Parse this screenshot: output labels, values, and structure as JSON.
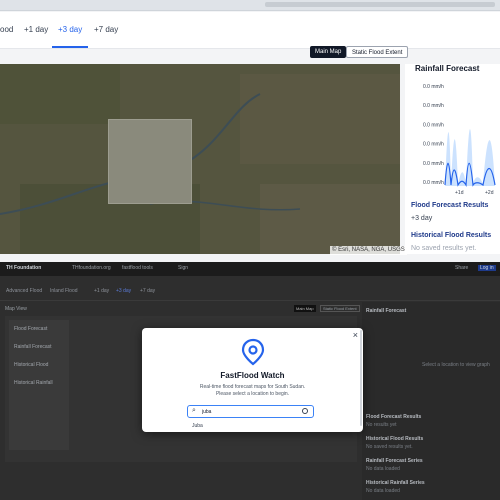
{
  "top": {
    "tabs": [
      {
        "label": "ood",
        "active": false
      },
      {
        "label": "+1 day",
        "active": false
      },
      {
        "label": "+3 day",
        "active": true
      },
      {
        "label": "+7 day",
        "active": false
      }
    ],
    "map_buttons": {
      "main": "Main Map",
      "static": "Static Flood Extent"
    },
    "attribution": "© Esri, NASA, NGA, USGS",
    "rainfall": {
      "title": "Rainfall Forecast",
      "y_ticks": [
        "0.0 mm/h",
        "0.0 mm/h",
        "0.0 mm/h",
        "0.0 mm/h",
        "0.0 mm/h",
        "0.0 mm/h"
      ],
      "x_ticks": [
        "+1d",
        "+2d"
      ]
    },
    "results": {
      "flood_label": "Flood Forecast Results",
      "flood_value": "+3 day",
      "historical_label": "Historical Flood Results",
      "historical_value": "No saved results yet."
    }
  },
  "bottom": {
    "header": {
      "org": "TH Foundation",
      "items": [
        "THfoundation.org",
        "fastflood tools",
        "Sign"
      ],
      "share": "Share",
      "login": "Log in"
    },
    "tabs": [
      "Advanced Flood",
      "Inland Flood",
      "+1 day",
      "+3 day",
      "+7 day"
    ],
    "map_view": "Map View",
    "buttons": [
      "Main Map",
      "Static Flood Extent"
    ],
    "layers": [
      "Flood Forecast",
      "Rainfall Forecast",
      "Historical Flood",
      "Historical Rainfall"
    ],
    "right": {
      "title": "Rainfall Forecast",
      "placeholder": "Select a location to view graph",
      "sections": [
        {
          "title": "Flood Forecast Results",
          "sub": "No results yet"
        },
        {
          "title": "Historical Flood Results",
          "sub": "No saved results yet."
        },
        {
          "title": "Rainfall Forecast Series",
          "sub": "No data loaded"
        },
        {
          "title": "Historical Rainfall Series",
          "sub": "No data loaded"
        }
      ]
    }
  },
  "modal": {
    "title": "FastFlood Watch",
    "description": "Real-time flood forecast maps for South Sudan.",
    "hint": "Please select a location to begin.",
    "search_value": "juba",
    "suggestion": "Juba"
  },
  "colors": {
    "accent": "#2563eb",
    "dark_button": "#111827",
    "series": "#2563eb"
  }
}
